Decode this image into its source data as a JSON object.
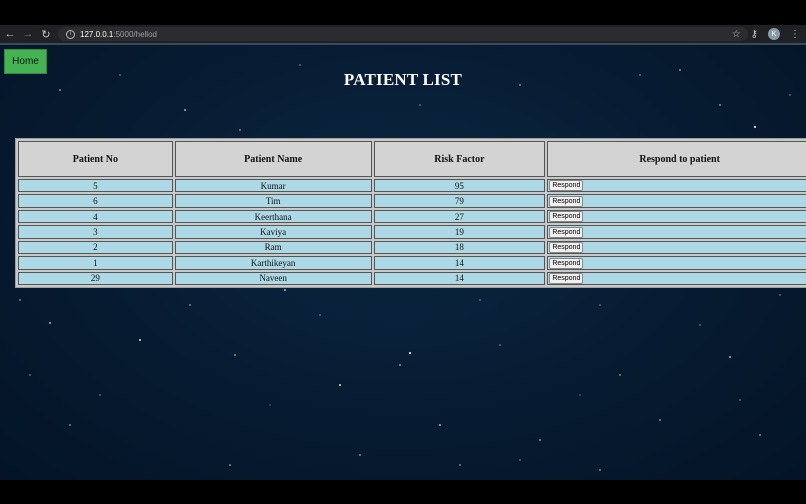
{
  "browser": {
    "url_host": "127.0.0.1",
    "url_path": ":5000/hellod",
    "profile_initial": "K"
  },
  "page": {
    "home_label": "Home",
    "title": "PATIENT LIST",
    "colors": {
      "home_button": "#45b255",
      "header_bg": "#d3d3d3",
      "row_bg": "#add8e6",
      "page_bg": "#061a30"
    }
  },
  "table": {
    "headers": [
      "Patient No",
      "Patient Name",
      "Risk Factor",
      "Respond to patient"
    ],
    "rows": [
      {
        "no": "5",
        "name": "Kumar",
        "risk": "95",
        "action": "Respond"
      },
      {
        "no": "6",
        "name": "Tim",
        "risk": "79",
        "action": "Respond"
      },
      {
        "no": "4",
        "name": "Keerthana",
        "risk": "27",
        "action": "Respond"
      },
      {
        "no": "3",
        "name": "Kaviya",
        "risk": "19",
        "action": "Respond"
      },
      {
        "no": "2",
        "name": "Ram",
        "risk": "18",
        "action": "Respond"
      },
      {
        "no": "1",
        "name": "Karthikeyan",
        "risk": "14",
        "action": "Respond"
      },
      {
        "no": "29",
        "name": "Naveen",
        "risk": "14",
        "action": "Respond"
      }
    ]
  }
}
